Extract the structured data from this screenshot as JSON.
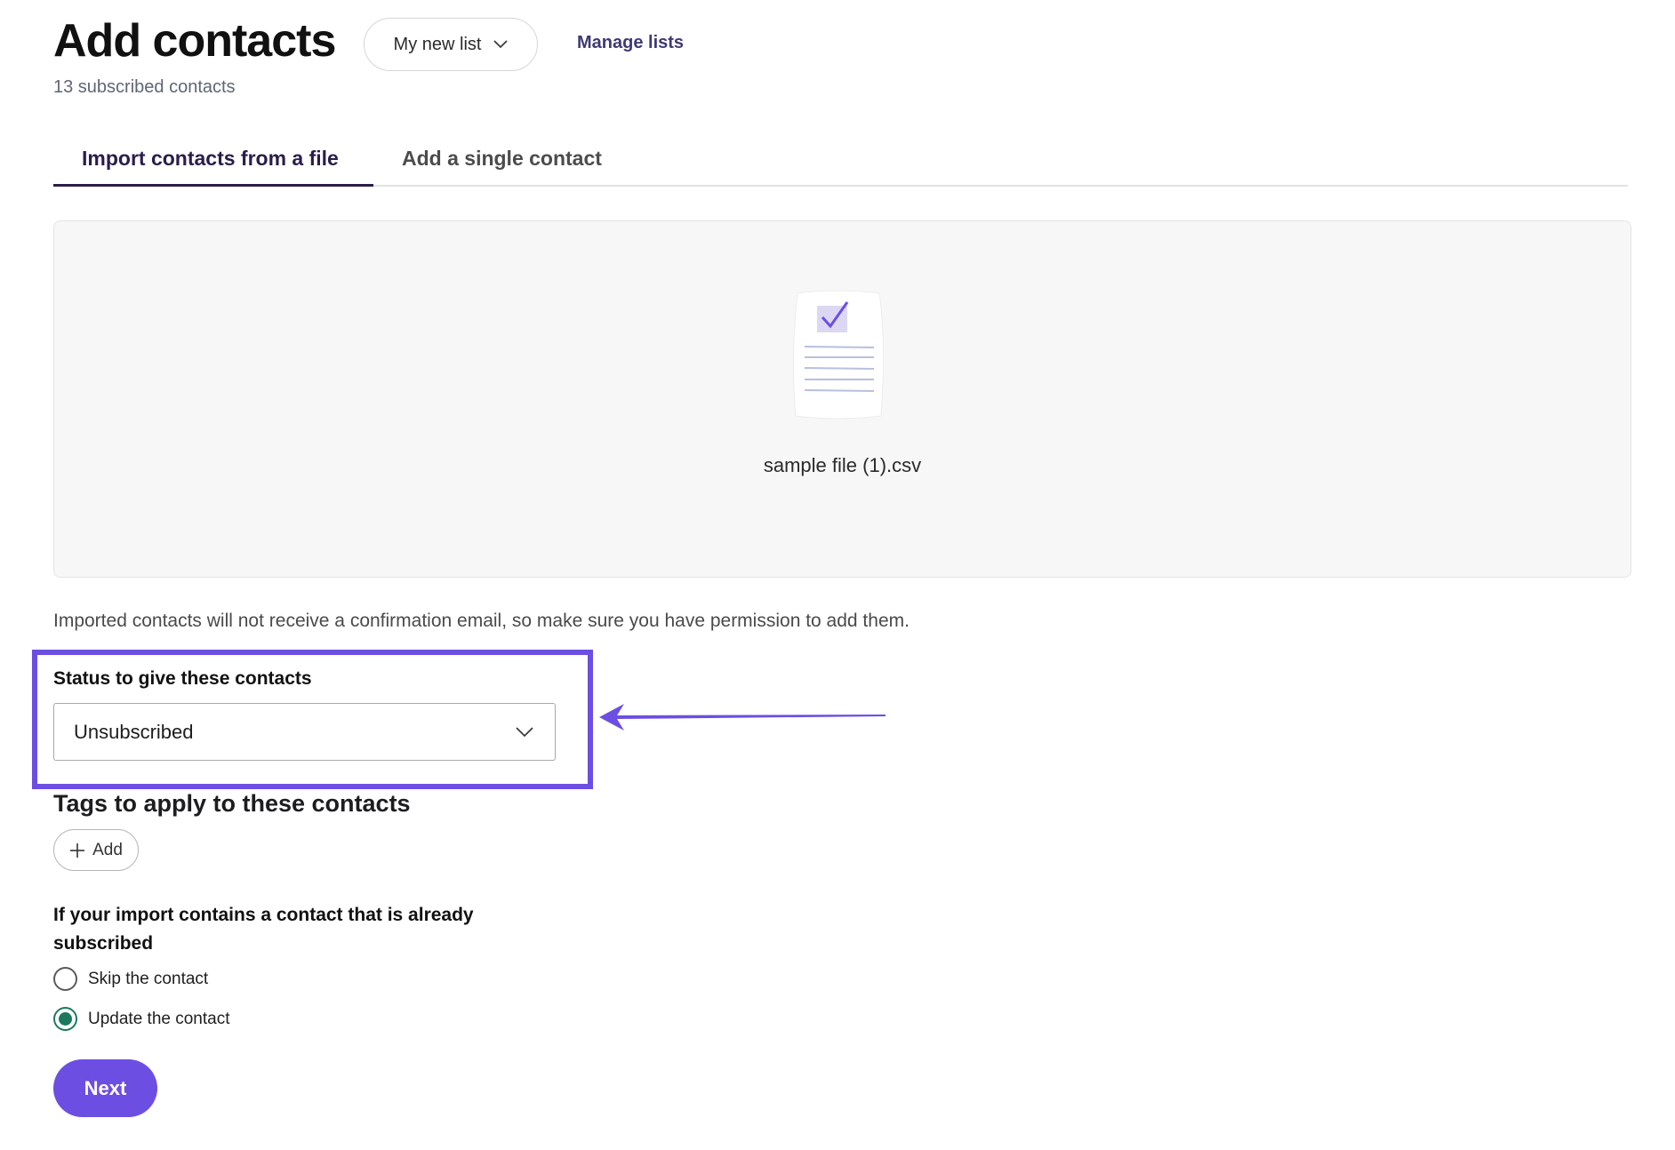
{
  "header": {
    "title": "Add contacts",
    "list_selector": "My new list",
    "manage_link": "Manage lists",
    "subscribed_count": "13 subscribed contacts"
  },
  "tabs": [
    {
      "label": "Import contacts from a file",
      "active": true
    },
    {
      "label": "Add a single contact",
      "active": false
    }
  ],
  "upload": {
    "filename": "sample file (1).csv",
    "icon": "document-check-icon"
  },
  "notice": "Imported contacts will not receive a confirmation email, so make sure you have permission to add them.",
  "status": {
    "label": "Status to give these contacts",
    "selected": "Unsubscribed"
  },
  "tags": {
    "label": "Tags to apply to these contacts",
    "add_label": "Add"
  },
  "duplicates": {
    "label": "If your import contains a contact that is already subscribed",
    "options": [
      {
        "label": "Skip the contact",
        "checked": false
      },
      {
        "label": "Update the contact",
        "checked": true
      }
    ]
  },
  "actions": {
    "next_label": "Next"
  },
  "colors": {
    "accent": "#6c4ee3",
    "tab_active": "#2b1d4a",
    "radio_checked": "#1b7a5c"
  }
}
